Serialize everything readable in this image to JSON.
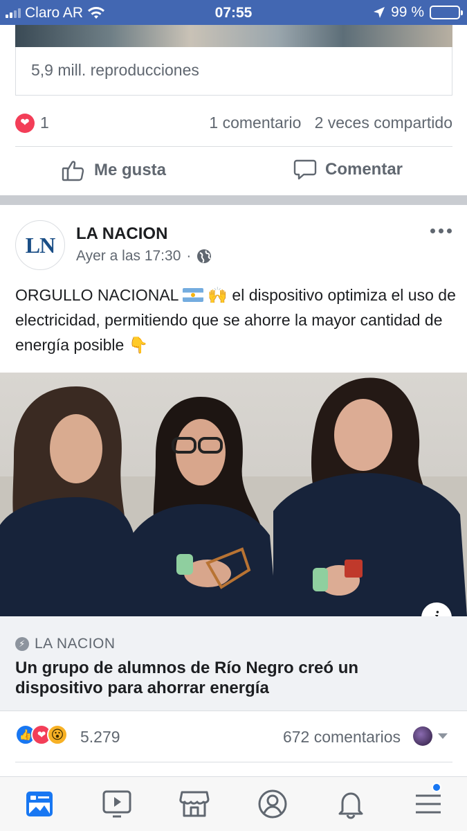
{
  "status_bar": {
    "carrier": "Claro AR",
    "time": "07:55",
    "battery": "99 %"
  },
  "previous_post": {
    "views": "5,9 mill. reproducciones",
    "reactions_count": "1",
    "comments": "1 comentario",
    "shares": "2 veces compartido",
    "like_label": "Me gusta",
    "comment_label": "Comentar"
  },
  "post": {
    "avatar_text": "LN",
    "page_name": "LA NACION",
    "timestamp": "Ayer a las 17:30",
    "separator": "·",
    "text_part1": "ORGULLO NACIONAL",
    "text_part2": "el dispositivo optimiza el uso de electricidad, permitiendo que se ahorre la mayor cantidad de energía posible",
    "emoji_hands": "🙌",
    "emoji_point": "👇",
    "link": {
      "source": "LA NACION",
      "title": "Un grupo de alumnos de Río Negro creó un dispositivo para ahorrar energía"
    },
    "reactions_count": "5.279",
    "comments_count": "672 comentarios"
  },
  "colors": {
    "brand": "#4267b2",
    "like": "#1877f2",
    "love": "#f33e58",
    "wow": "#f7b125"
  },
  "tabs": [
    "news-feed-icon",
    "watch-icon",
    "marketplace-icon",
    "profile-icon",
    "notifications-icon",
    "menu-icon"
  ]
}
